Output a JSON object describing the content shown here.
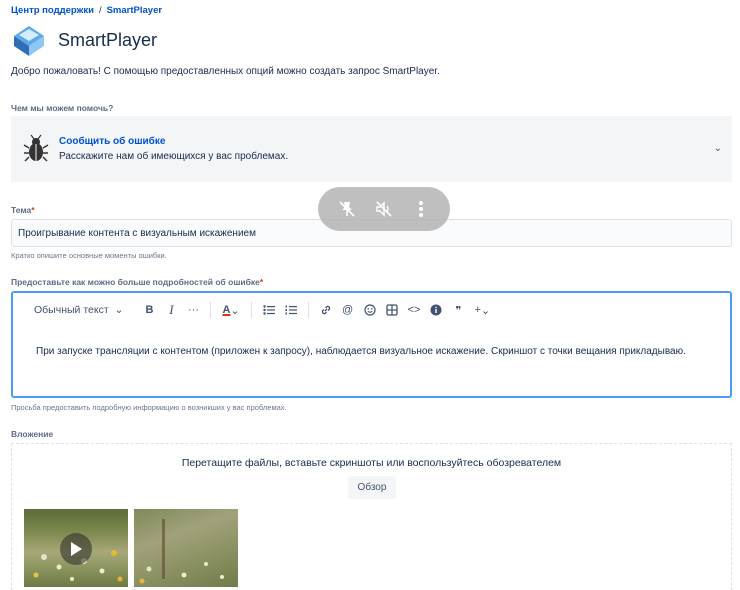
{
  "breadcrumb": [
    "Центр поддержки",
    "SmartPlayer"
  ],
  "portal": {
    "title": "SmartPlayer"
  },
  "welcome": "Добро пожаловать! С помощью предоставленных опций можно создать запрос SmartPlayer.",
  "help_label": "Чем мы можем помочь?",
  "request_type": {
    "title": "Сообщить об ошибке",
    "description": "Расскажите нам об имеющихся у вас проблемах.",
    "icon": "bug-icon"
  },
  "subject": {
    "label": "Тема",
    "value": "Проигрывание контента с визуальным искажением",
    "hint": "Кратко опишите основные моменты ошибки."
  },
  "description": {
    "label": "Предоставьте как можно больше подробностей об ошибке",
    "toolbar": {
      "text_style": "Обычный текст",
      "bold": "B",
      "italic": "I",
      "more": "···",
      "color": "A",
      "mention": "@",
      "code": "<>",
      "quote": "❞",
      "insert": "+"
    },
    "body": "При запуске трансляции с контентом (приложен к запросу), наблюдается визуальное искажение. Скриншот с точки вещания прикладываю.",
    "hint": "Просьба предоставить подробную информацию о возникших у вас проблемах."
  },
  "attachment": {
    "label": "Вложение",
    "drop_text": "Перетащите файлы, вставьте скриншоты или воспользуйтесь обозревателем",
    "browse_label": "Обзор"
  },
  "colors": {
    "link": "#0052cc",
    "focus": "#4c9aff",
    "required": "#de350b"
  }
}
